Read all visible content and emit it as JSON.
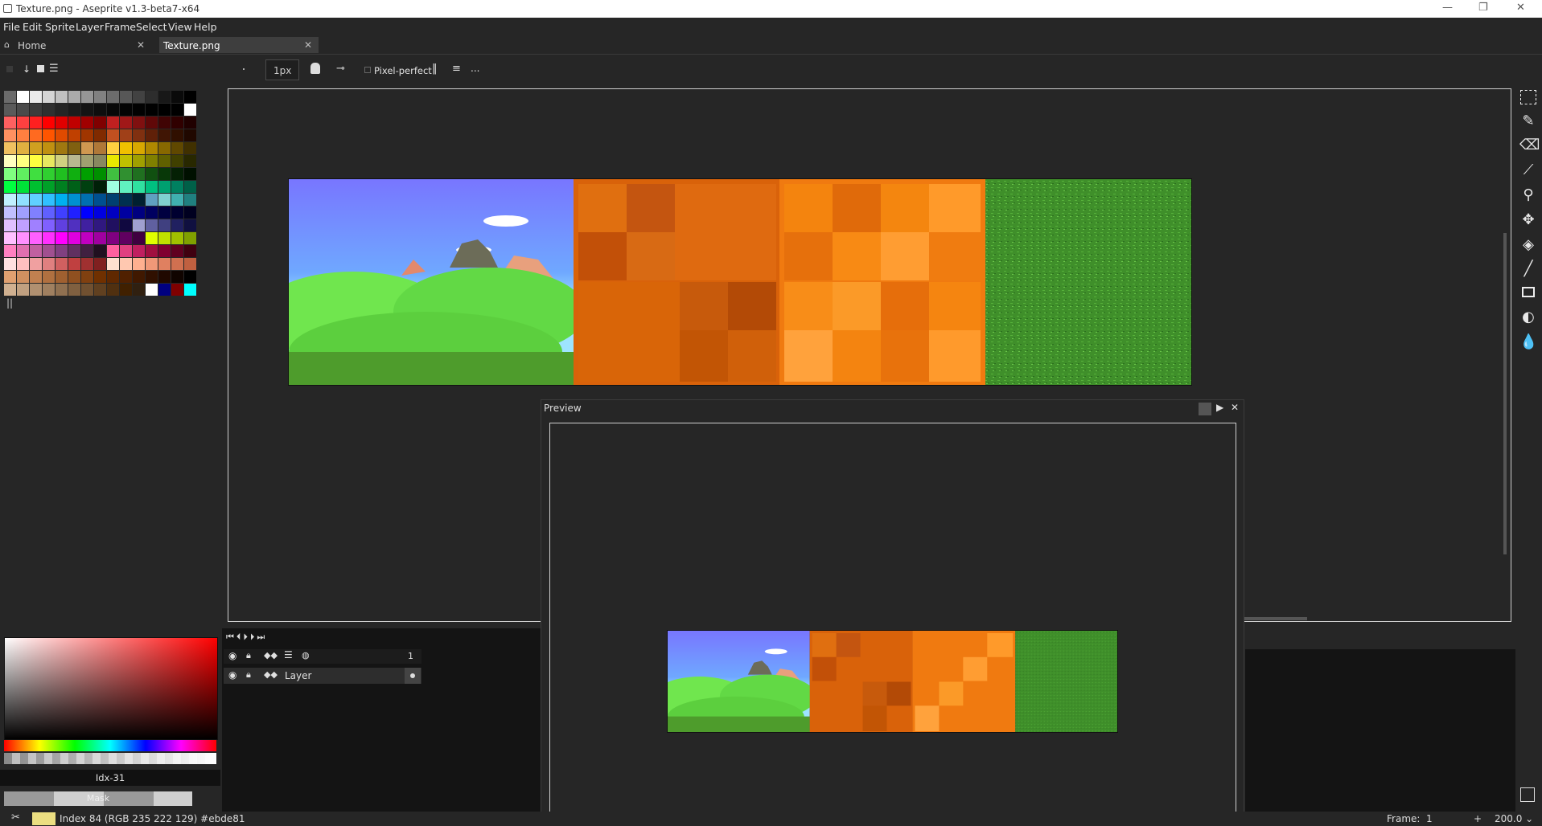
{
  "window": {
    "title": "Texture.png - Aseprite v1.3-beta7-x64",
    "minimize_glyph": "—",
    "restore_glyph": "❐",
    "close_glyph": "✕"
  },
  "menu": [
    "File",
    "Edit",
    "Sprite",
    "Layer",
    "Frame",
    "Select",
    "View",
    "Help"
  ],
  "tabs": [
    {
      "label": "Home",
      "close": "✕"
    },
    {
      "label": "Texture.png",
      "close": "✕"
    }
  ],
  "toolbar": {
    "brush_size": "1px",
    "pixel_perfect": "Pixel-perfect",
    "more": "..."
  },
  "palette_rows": [
    [
      "#6b6b6b",
      "#ffffff",
      "#eaeaea",
      "#d5d5d5",
      "#c0c0c0",
      "#ababab",
      "#969696",
      "#818181",
      "#6c6c6c",
      "#575757",
      "#424242",
      "#2d2d2d",
      "#181818",
      "#0a0a0a",
      "#000000"
    ],
    [
      "#5a5a5a",
      "#4a4a4a",
      "#3c3c3c",
      "#303030",
      "#252525",
      "#1c1c1c",
      "#141414",
      "#0e0e0e",
      "#080808",
      "#040404",
      "#020202",
      "#010101",
      "#000000",
      "#000000",
      "#ffffff"
    ],
    [
      "#ff6060",
      "#ff4040",
      "#ff2020",
      "#ff0000",
      "#e00000",
      "#c00000",
      "#a00000",
      "#800000",
      "#c02020",
      "#a01818",
      "#801010",
      "#600808",
      "#400404",
      "#300000",
      "#200000"
    ],
    [
      "#ff9060",
      "#ff7f40",
      "#ff6a20",
      "#ff5500",
      "#e04a00",
      "#c04000",
      "#a03500",
      "#802a00",
      "#c05020",
      "#a04018",
      "#803010",
      "#602008",
      "#401504",
      "#300f00",
      "#200800"
    ],
    [
      "#f0c060",
      "#e0b040",
      "#d0a020",
      "#c09010",
      "#a07810",
      "#806010",
      "#d09850",
      "#b07838",
      "#ffd040",
      "#f0c000",
      "#d8a800",
      "#b08800",
      "#886800",
      "#604800",
      "#403000"
    ],
    [
      "#ffffc0",
      "#ffff80",
      "#ffff40",
      "#e8e860",
      "#d0d080",
      "#b8b890",
      "#a0a070",
      "#888860",
      "#e8e800",
      "#c0c000",
      "#a0a000",
      "#808000",
      "#606000",
      "#404000",
      "#282800"
    ],
    [
      "#80ff80",
      "#60ef60",
      "#40df40",
      "#30cf30",
      "#20bf20",
      "#10af10",
      "#009f00",
      "#008f00",
      "#40c040",
      "#309030",
      "#207020",
      "#105010",
      "#083808",
      "#042004",
      "#001000"
    ],
    [
      "#00ff40",
      "#00e038",
      "#00c030",
      "#00a028",
      "#008020",
      "#006018",
      "#004010",
      "#002008",
      "#a0ffe0",
      "#60f0c0",
      "#30e0a0",
      "#00c080",
      "#00a070",
      "#008060",
      "#006048"
    ],
    [
      "#c0f0ff",
      "#90e0ff",
      "#60d0ff",
      "#30c0ff",
      "#00b0f0",
      "#0090d0",
      "#0070b0",
      "#005090",
      "#004070",
      "#003050",
      "#002030",
      "#60a0c0",
      "#80d0d0",
      "#40b0b0",
      "#208080"
    ],
    [
      "#c0c0ff",
      "#a0a0ff",
      "#8080ff",
      "#6060ff",
      "#4040ff",
      "#2020ff",
      "#0000ff",
      "#0000e0",
      "#0000c0",
      "#0000a0",
      "#000080",
      "#000060",
      "#000040",
      "#000030",
      "#000020"
    ],
    [
      "#e0c0ff",
      "#c0a0ff",
      "#a080ff",
      "#8060ff",
      "#6040e0",
      "#5030c0",
      "#4020a0",
      "#301880",
      "#201060",
      "#100840",
      "#a0a0d0",
      "#6060a0",
      "#404080",
      "#202060",
      "#101040"
    ],
    [
      "#ffc0ff",
      "#ff90ff",
      "#ff60ff",
      "#ff30ff",
      "#ff00ff",
      "#e000e0",
      "#c000c0",
      "#a000a0",
      "#800080",
      "#600060",
      "#400040",
      "#e0ff00",
      "#c0e000",
      "#a0c000",
      "#80a000"
    ],
    [
      "#ff80c0",
      "#e070b0",
      "#c060a0",
      "#a05090",
      "#804080",
      "#603060",
      "#402040",
      "#201020",
      "#ff60a0",
      "#e04080",
      "#c02060",
      "#a01040",
      "#800030",
      "#600020",
      "#400010"
    ],
    [
      "#ffe0e0",
      "#ffc0c0",
      "#f0a0a0",
      "#e08080",
      "#d06060",
      "#c04040",
      "#a03030",
      "#802020",
      "#ffe0d0",
      "#ffc8b0",
      "#ffb090",
      "#f09878",
      "#e08060",
      "#d07050",
      "#c06040"
    ],
    [
      "#e0a070",
      "#d09060",
      "#c08050",
      "#b07040",
      "#a06030",
      "#905020",
      "#804010",
      "#703000",
      "#602800",
      "#502000",
      "#401800",
      "#301000",
      "#200800",
      "#100400",
      "#000000"
    ],
    [
      "#d0b090",
      "#c0a080",
      "#b09070",
      "#a08060",
      "#907050",
      "#806040",
      "#705030",
      "#604020",
      "#503010",
      "#402000",
      "#302010",
      "#ffffff",
      "#000080",
      "#800000",
      "#00ffff"
    ]
  ],
  "timeline": {
    "frame_number": "1",
    "layer_name": "Layer"
  },
  "preview": {
    "title": "Preview"
  },
  "color": {
    "index_label": "Idx-31",
    "mask_label": "Mask"
  },
  "status": {
    "text": "Index 84 (RGB 235 222 129) #ebde81",
    "swatch": "#ebde81",
    "frame_label": "Frame:",
    "frame_value": "1",
    "plus": "+",
    "zoom": "200.0 ⌄"
  }
}
